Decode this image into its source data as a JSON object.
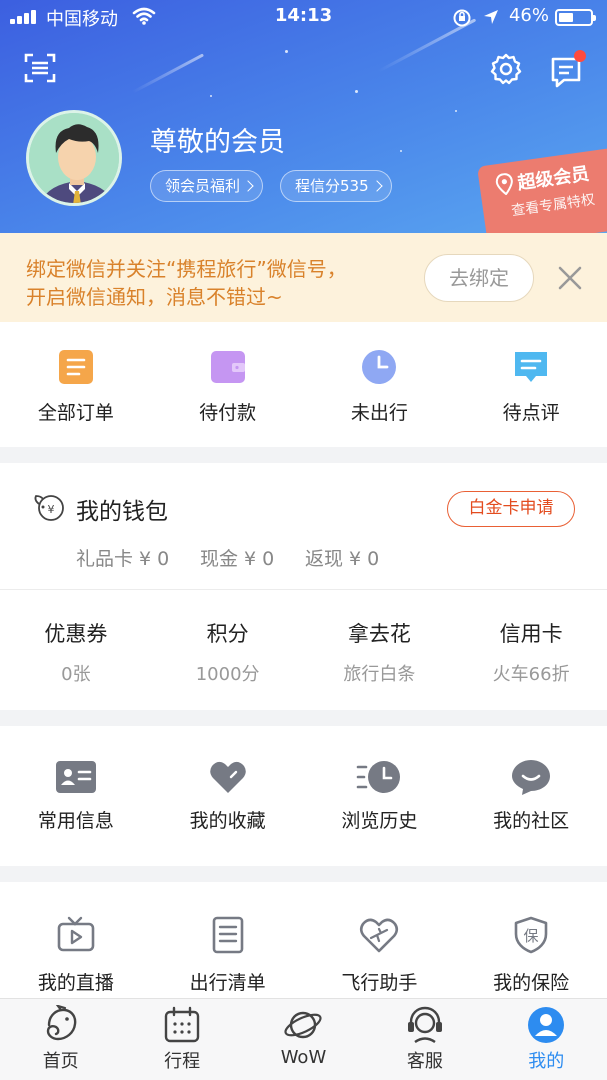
{
  "status_bar": {
    "carrier": "中国移动",
    "time": "14:13",
    "battery": "46%",
    "battery_level": 0.46
  },
  "header": {
    "greeting": "尊敬的会员",
    "pill_welfare": "领会员福利",
    "pill_credit": "程信分535",
    "super_title": "超级会员",
    "super_sub": "查看专属特权",
    "scan_icon": "scan-icon",
    "settings_icon": "gear-icon",
    "messages_icon": "message-icon",
    "has_unread": true
  },
  "notice": {
    "line1": "绑定微信并关注“携程旅行”微信号，",
    "line2": "开启微信通知，消息不错过~",
    "bind_button": "去绑定"
  },
  "orders": [
    {
      "label": "全部订单",
      "icon": "all-orders-icon",
      "color": "#f5a64a"
    },
    {
      "label": "待付款",
      "icon": "wallet-icon",
      "color": "#c596f2"
    },
    {
      "label": "未出行",
      "icon": "clock-icon",
      "color": "#8fa8f3"
    },
    {
      "label": "待点评",
      "icon": "comment-icon",
      "color": "#4fb8f0"
    }
  ],
  "wallet": {
    "title": "我的钱包",
    "platinum_button": "白金卡申请",
    "balances": [
      "礼品卡 ¥ 0",
      "现金 ¥ 0",
      "返现 ¥ 0"
    ],
    "finance": [
      {
        "title": "优惠券",
        "sub": "0张"
      },
      {
        "title": "积分",
        "sub": "1000分"
      },
      {
        "title": "拿去花",
        "sub": "旅行白条"
      },
      {
        "title": "信用卡",
        "sub": "火车66折"
      }
    ]
  },
  "services1": [
    {
      "label": "常用信息",
      "icon": "id-card-icon"
    },
    {
      "label": "我的收藏",
      "icon": "heart-icon"
    },
    {
      "label": "浏览历史",
      "icon": "history-icon"
    },
    {
      "label": "我的社区",
      "icon": "chat-bubble-icon"
    }
  ],
  "services2": [
    {
      "label": "我的直播",
      "icon": "tv-icon"
    },
    {
      "label": "出行清单",
      "icon": "checklist-icon"
    },
    {
      "label": "飞行助手",
      "icon": "flight-heart-icon"
    },
    {
      "label": "我的保险",
      "icon": "insurance-shield-icon",
      "glyph": "保"
    }
  ],
  "tabs": [
    {
      "label": "首页",
      "icon": "home-dolphin-icon",
      "active": false
    },
    {
      "label": "行程",
      "icon": "calendar-icon",
      "active": false
    },
    {
      "label": "WoW",
      "icon": "planet-icon",
      "active": false
    },
    {
      "label": "客服",
      "icon": "headset-icon",
      "active": false
    },
    {
      "label": "我的",
      "icon": "user-icon",
      "active": true
    }
  ],
  "colors": {
    "header_gradient": [
      "#3c5fe0",
      "#5aa6f0"
    ],
    "notice_text": "#d9822b",
    "accent_red": "#e34c1f",
    "active_tab": "#2d8cf0"
  }
}
